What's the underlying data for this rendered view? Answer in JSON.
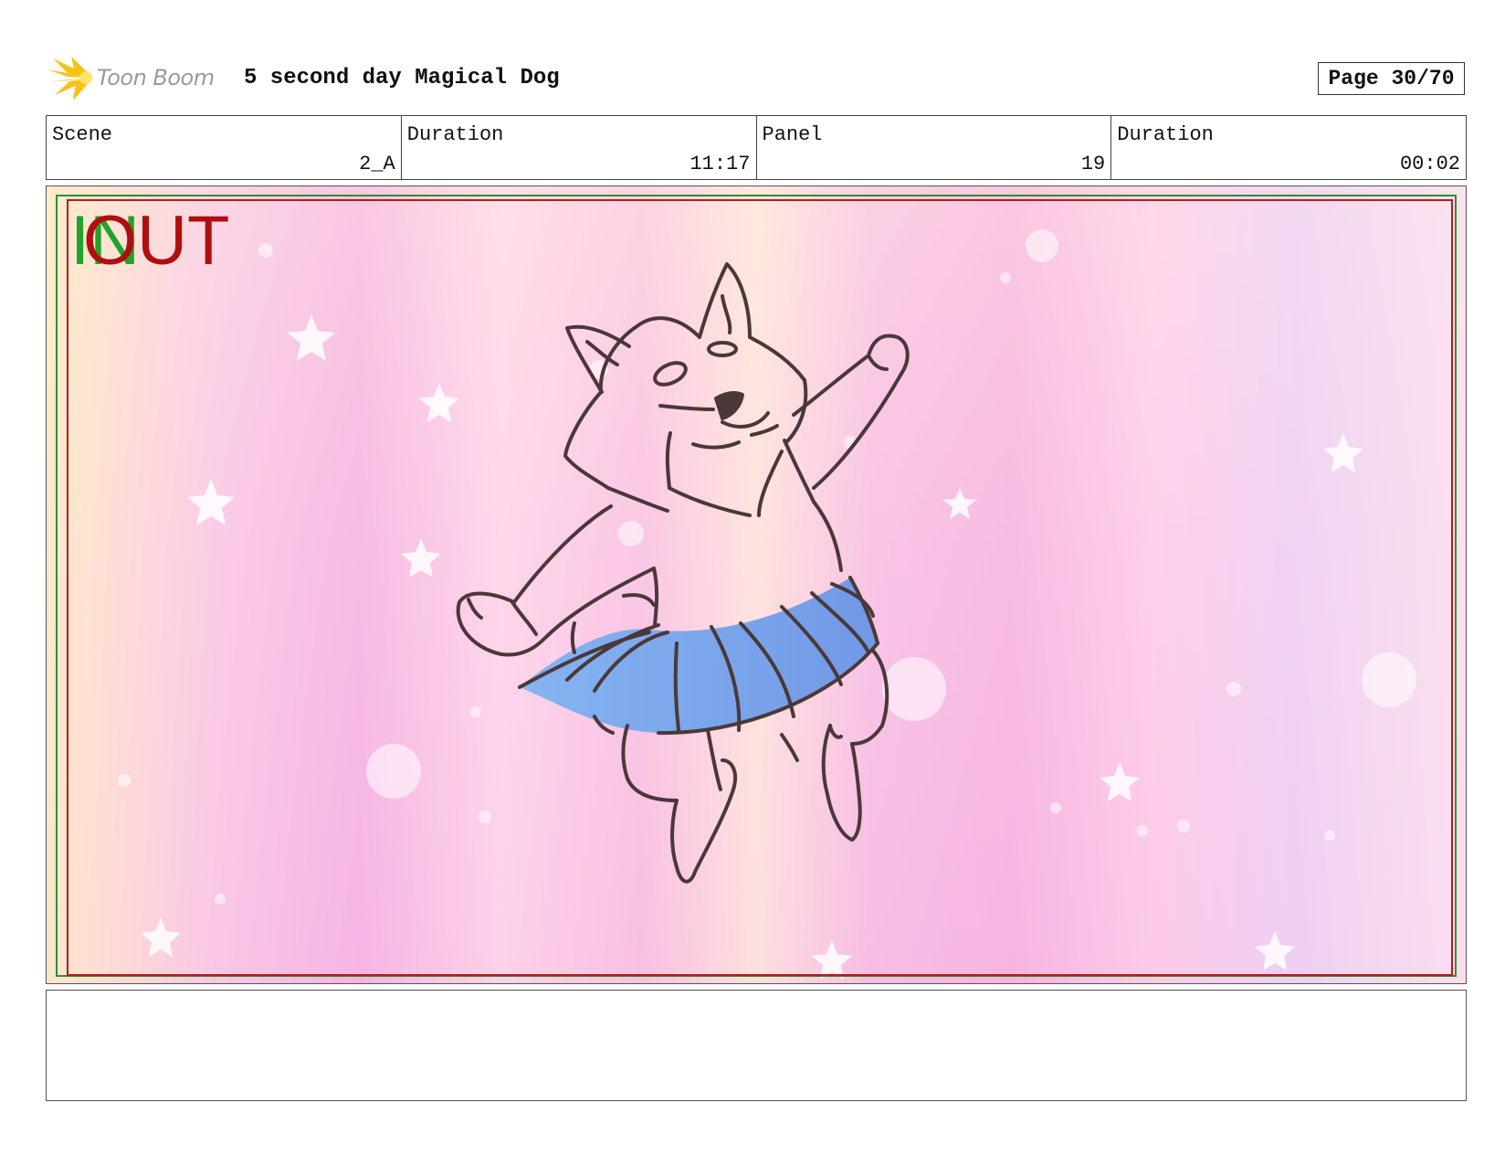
{
  "header": {
    "logo_text": "Toon Boom",
    "title": "5 second day Magical Dog",
    "page_label": "Page 30/70"
  },
  "info": {
    "scene_label": "Scene",
    "scene_value": "2_A",
    "scene_duration_label": "Duration",
    "scene_duration_value": "11:17",
    "panel_label": "Panel",
    "panel_value": "19",
    "panel_duration_label": "Duration",
    "panel_duration_value": "00:02"
  },
  "panel": {
    "in_marker": "IN",
    "out_marker": "OUT",
    "colors": {
      "in_marker": "#22a22a",
      "out_marker": "#b00f0f",
      "skirt": "#6ea4ec",
      "line_art": "#4a3838"
    }
  },
  "notes": {
    "text": ""
  }
}
